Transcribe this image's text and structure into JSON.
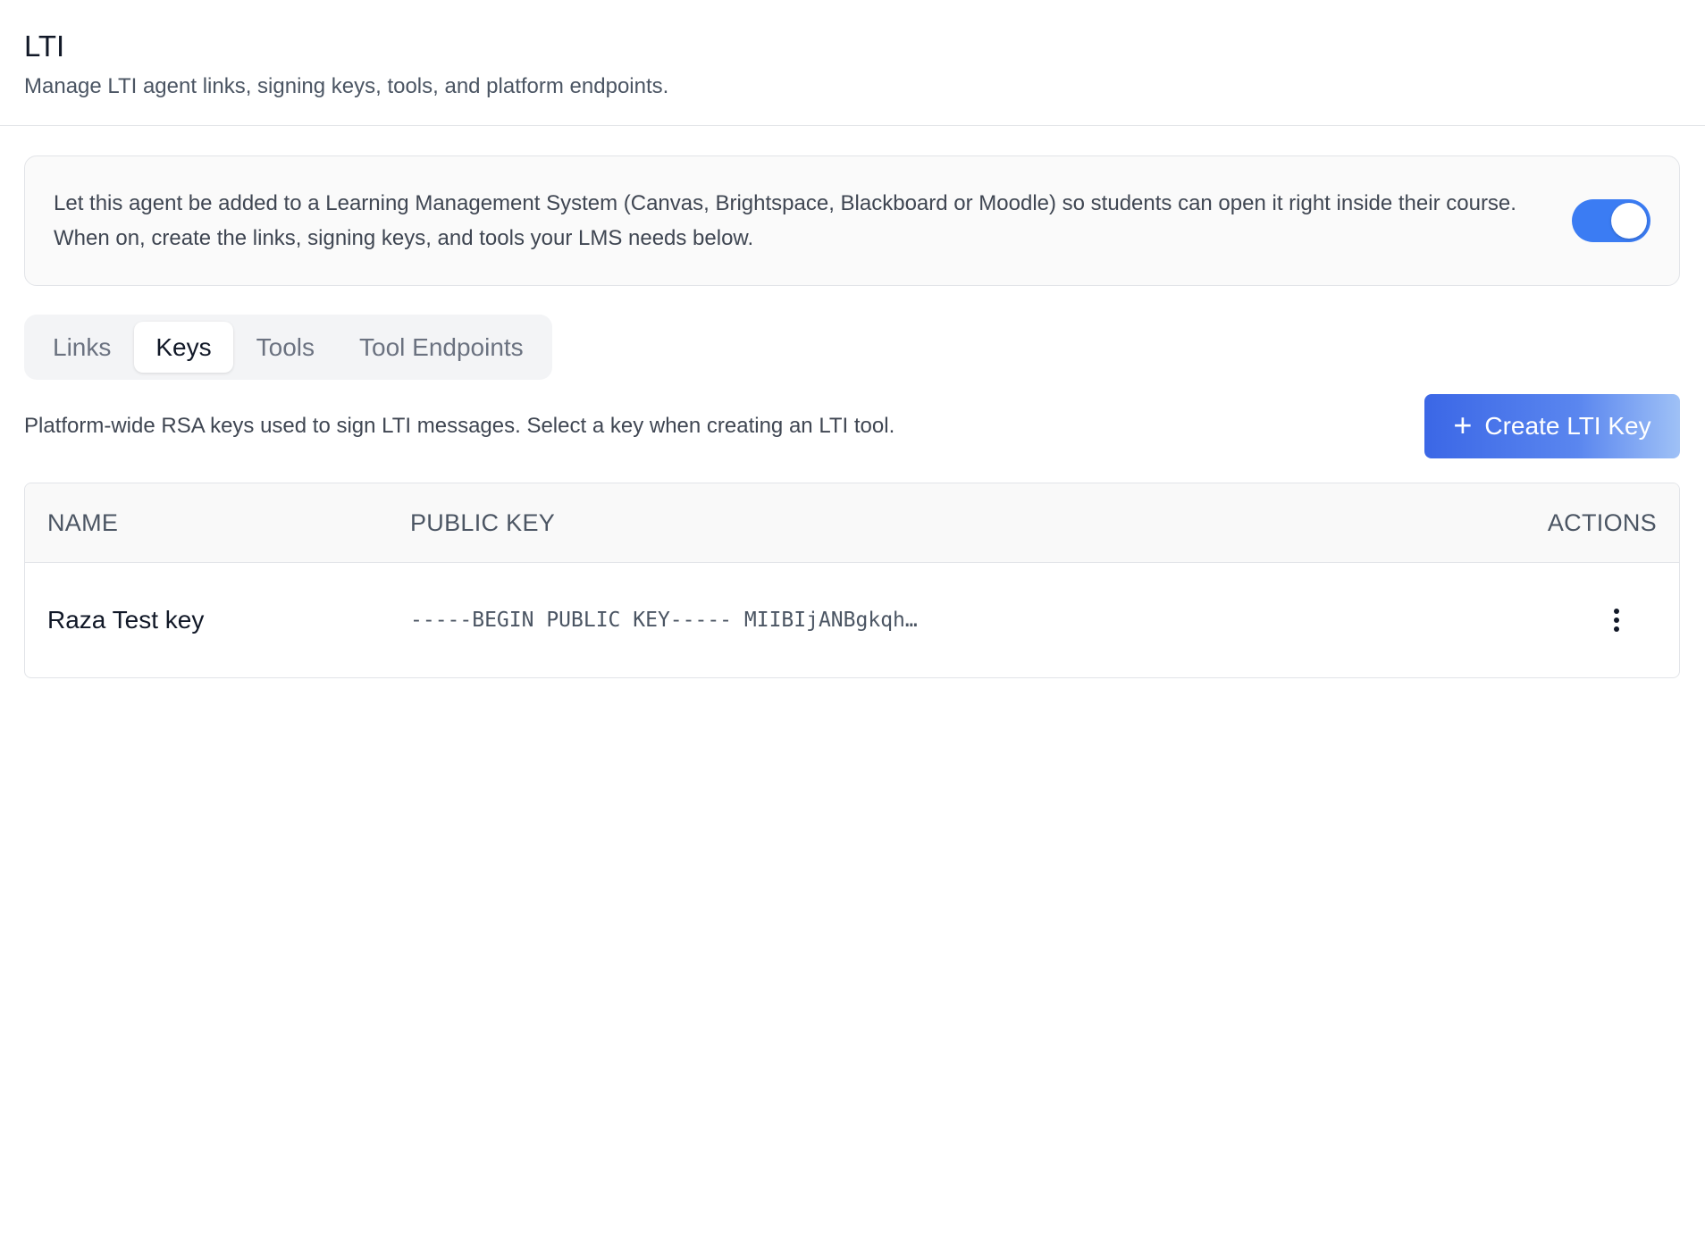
{
  "header": {
    "title": "LTI",
    "subtitle": "Manage LTI agent links, signing keys, tools, and platform endpoints."
  },
  "info_card": {
    "text": "Let this agent be added to a Learning Management System (Canvas, Brightspace, Blackboard or Moodle) so students can open it right inside their course. When on, create the links, signing keys, and tools your LMS needs below.",
    "toggle_on": true
  },
  "tabs": [
    {
      "label": "Links",
      "active": false
    },
    {
      "label": "Keys",
      "active": true
    },
    {
      "label": "Tools",
      "active": false
    },
    {
      "label": "Tool Endpoints",
      "active": false
    }
  ],
  "keys_section": {
    "description": "Platform-wide RSA keys used to sign LTI messages. Select a key when creating an LTI tool.",
    "create_button_label": "Create LTI Key",
    "create_button_icon": "plus-icon"
  },
  "table": {
    "columns": [
      "NAME",
      "PUBLIC KEY",
      "ACTIONS"
    ],
    "rows": [
      {
        "name": "Raza Test key",
        "public_key": "-----BEGIN PUBLIC KEY----- MIIBIjANBgkqh…",
        "actions_icon": "more-vertical-icon"
      }
    ]
  },
  "colors": {
    "accent": "#3b7cf3",
    "button_gradient_start": "#3b67e6",
    "button_gradient_end": "#9fc1f6"
  }
}
